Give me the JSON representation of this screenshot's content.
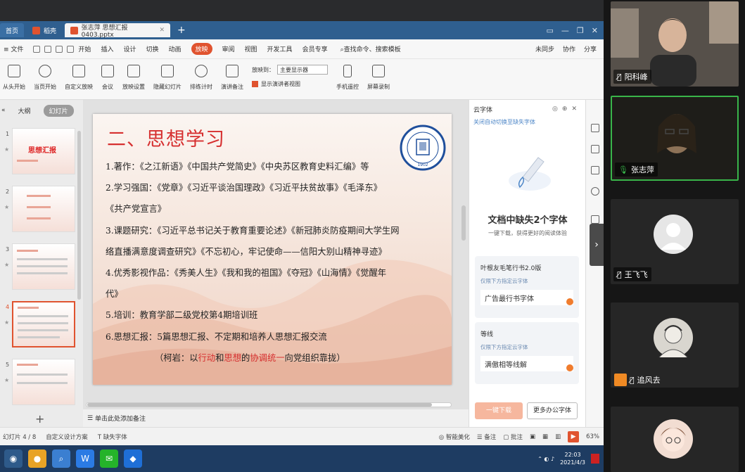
{
  "app": {
    "tabs": [
      {
        "label": "首页"
      },
      {
        "label": "稻壳"
      },
      {
        "label": "张志萍 思想汇报 0403.pptx"
      }
    ],
    "menu": [
      "文件",
      "开始",
      "插入",
      "设计",
      "切换",
      "动画",
      "放映",
      "审阅",
      "视图",
      "开发工具",
      "会员专享"
    ],
    "active_menu": "放映",
    "search_placeholder": "查找命令、搜索模板",
    "menu_right": [
      "未同步",
      "协作",
      "分享"
    ],
    "ribbon": [
      "从头开始",
      "当页开始",
      "自定义放映",
      "会议",
      "放映设置",
      "隐藏幻灯片",
      "排练计时",
      "演讲备注",
      "手机遥控",
      "屏幕录制"
    ],
    "ribbon_select_label": "放映到：",
    "ribbon_select_value": "主要显示器",
    "ribbon_check_label": "显示演讲者视图",
    "thumb_tabs": {
      "outline": "大纲",
      "slides": "幻灯片"
    },
    "thumb_numbers": [
      "1",
      "2",
      "3",
      "4",
      "5"
    ],
    "thumb_titles": [
      "思想汇报",
      "",
      "",
      "",
      ""
    ],
    "notes_placeholder": "单击此处添加备注",
    "status": {
      "slide": "幻灯片 4 / 8",
      "theme": "自定义设计方案",
      "missing": "缺失字体",
      "beautify": "智能美化",
      "notes": "备注",
      "comments": "批注",
      "zoom": "63%"
    }
  },
  "slide": {
    "title": "二、思想学习",
    "lines": [
      "1.著作：《之江新语》《中国共产党简史》《中央苏区教育史料汇编》等",
      "2.学习强国：《党章》《习近平谈治国理政》《习近平扶贫故事》《毛泽东》",
      "《共产党宣言》",
      "3.课题研究：《习近平总书记关于教育重要论述》《新冠肺炎防疫期间大学生网",
      "络直播满意度调查研究》《不忘初心，牢记使命——信阳大别山精神寻迹》",
      "4.优秀影视作品：《秀美人生》《我和我的祖国》《夺冠》《山海情》《觉醒年",
      "代》",
      "5.培训：教育学部二级党校第4期培训班",
      "6.思想汇报：5篇思想汇报、不定期和培养人思想汇报交流"
    ],
    "quote": {
      "pre": "（柯岩：以",
      "r1": "行动",
      "mid1": "和",
      "r2": "思想",
      "mid2": "的",
      "r3": "协调统一",
      "post": "向党组织靠拢）"
    },
    "seal": {
      "top": "BEIJING NORMAL UNIVERSITY",
      "year": "1902"
    }
  },
  "font_panel": {
    "title": "云字体",
    "link": "关闭自动切换至缺失字体",
    "headline": "文档中缺失2个字体",
    "subline": "一键下载，获得更好的阅读体验",
    "fonts": [
      {
        "name": "叶根友毛笔行书2.0版",
        "hint": "仅限下方指定云字体",
        "sample": "广告最行书字体"
      },
      {
        "name": "等线",
        "hint": "仅限下方指定云字体",
        "sample": "满傲相等线解"
      }
    ],
    "btn_download": "一键下载",
    "btn_more": "更多办公字体"
  },
  "taskbar": {
    "time": "22:03",
    "date": "2021/4/3"
  },
  "participants": [
    {
      "name": "阳科峰",
      "speaking": false,
      "muted": true
    },
    {
      "name": "张志萍",
      "speaking": true,
      "muted": false
    },
    {
      "name": "王飞飞",
      "speaking": false,
      "muted": true
    },
    {
      "name": "追风去",
      "speaking": false,
      "muted": true
    },
    {
      "name": "",
      "speaking": false,
      "muted": true
    }
  ],
  "colors": {
    "accent": "#e0532f",
    "speaking": "#39b54a",
    "slide_title": "#d62f2f"
  }
}
